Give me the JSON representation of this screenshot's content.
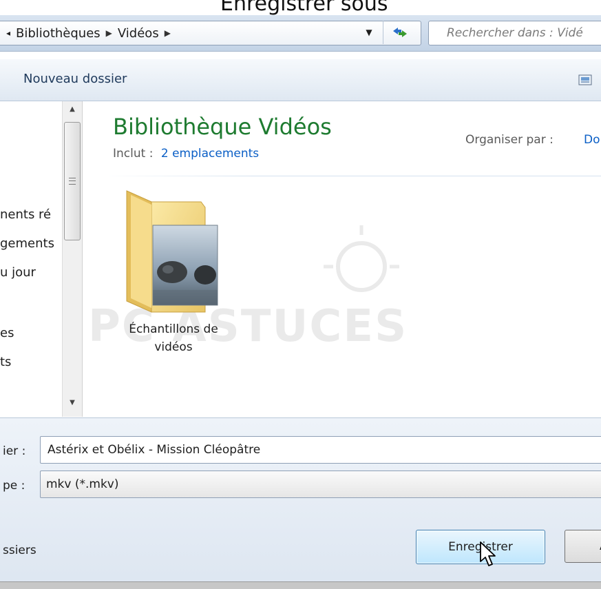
{
  "window": {
    "title_fragment": "Enregistrer sous"
  },
  "address_bar": {
    "crumbs": [
      "Bibliothèques",
      "Vidéos"
    ],
    "search_placeholder": "Rechercher dans : Vidé"
  },
  "toolbar": {
    "new_folder_label": "Nouveau dossier"
  },
  "nav_pane": {
    "items": [
      "nents ré",
      "gements",
      "u jour",
      "es",
      "ts"
    ]
  },
  "content": {
    "library_title": "Bibliothèque Vidéos",
    "includes_label": "Inclut :",
    "includes_link": "2 emplacements",
    "organize_label": "Organiser par :",
    "organize_value": "Do",
    "watermark": "PC ASTUCES",
    "folder": {
      "label_line1": "Échantillons de",
      "label_line2": "vidéos"
    }
  },
  "form": {
    "filename_label": "ier :",
    "filename_value": "Astérix et Obélix - Mission Cléopâtre",
    "type_label": "pe :",
    "type_value": "mkv (*.mkv)",
    "hide_folders_label": "ssiers",
    "save_button_label": "Enregistrer",
    "cancel_button_label": "A"
  },
  "colors": {
    "library_title": "#1e7b30",
    "link": "#0b5fc6",
    "toolbar_text": "#1e395b"
  }
}
